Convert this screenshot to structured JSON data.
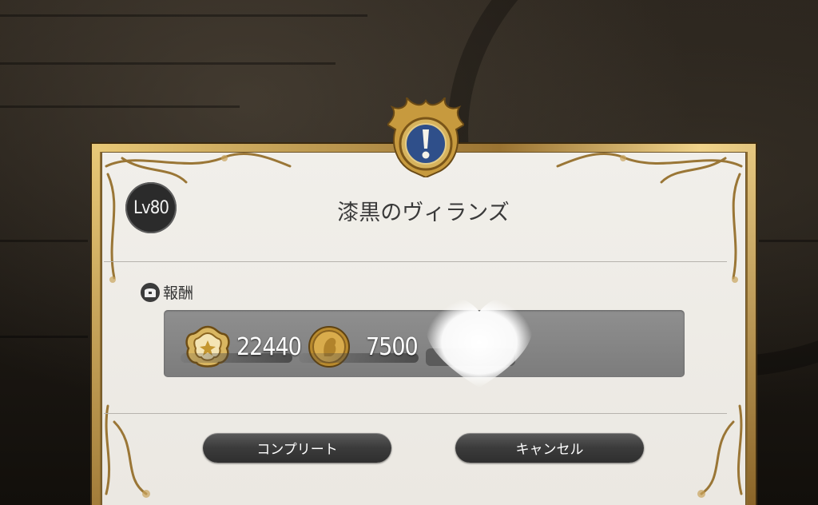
{
  "dialog": {
    "level": "Lv80",
    "title": "漆黒のヴィランズ",
    "rewards_label": "報酬",
    "rewards": [
      {
        "icon": "gil-seal-icon",
        "value": "22440"
      },
      {
        "icon": "gold-coin-icon",
        "value": "7500"
      }
    ],
    "buttons": {
      "complete": "コンプリート",
      "cancel": "キャンセル"
    }
  },
  "colors": {
    "frame_gold": "#b08a45",
    "panel_bg": "#efece7",
    "crest_blue": "#2f4f8a",
    "button_dark": "#3b3b3b"
  }
}
